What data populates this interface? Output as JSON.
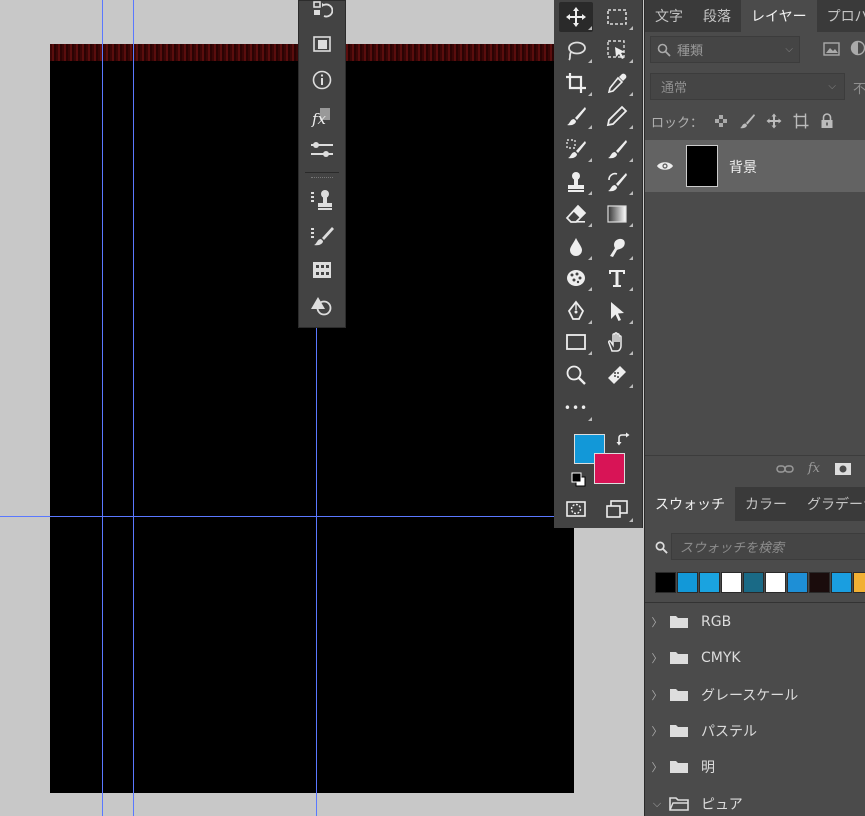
{
  "mini_dock": {
    "items": [
      "history",
      "properties-panel",
      "info",
      "styles",
      "adjustments",
      "clone-source",
      "brush-settings",
      "grid",
      "shapes"
    ]
  },
  "toolbar": {
    "colors": {
      "foreground": "#1298d8",
      "background": "#d81456"
    },
    "more_label": "•••"
  },
  "layers_panel": {
    "tabs": [
      "文字",
      "段落",
      "レイヤー",
      "プロパティ"
    ],
    "active_tab": "レイヤー",
    "search_placeholder": "種類",
    "blend_mode": "通常",
    "opacity_prefix": "不",
    "lock_label": "ロック：",
    "layers": [
      {
        "name": "背景",
        "visible": true
      }
    ],
    "footer_fx": "fx"
  },
  "swatches_panel": {
    "tabs": [
      "スウォッチ",
      "カラー",
      "グラデーション"
    ],
    "active_tab": "スウォッチ",
    "search_placeholder": "スウォッチを検索",
    "recent_colors": [
      "#000000",
      "#1298d8",
      "#1aa3e0",
      "#ffffff",
      "#1a6a86",
      "#ffffff",
      "#1e8fd6",
      "#1a0c0c",
      "#1a9ee0",
      "#f2b033"
    ],
    "groups": [
      {
        "name": "RGB",
        "expanded": false
      },
      {
        "name": "CMYK",
        "expanded": false
      },
      {
        "name": "グレースケール",
        "expanded": false
      },
      {
        "name": "パステル",
        "expanded": false
      },
      {
        "name": "明",
        "expanded": false
      },
      {
        "name": "ピュア",
        "expanded": true
      }
    ]
  }
}
